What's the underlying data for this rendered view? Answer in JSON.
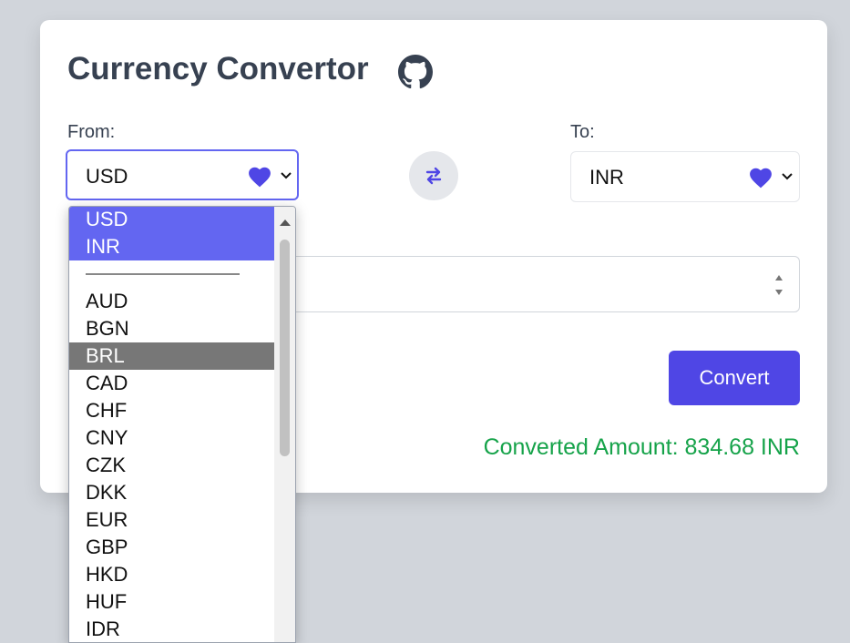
{
  "app": {
    "title": "Currency Convertor",
    "github_icon": "github-icon"
  },
  "from": {
    "label": "From:",
    "value": "USD",
    "favorite_icon": "heart-icon",
    "heart_color": "#4f46e5"
  },
  "to": {
    "label": "To:",
    "value": "INR",
    "favorite_icon": "heart-icon"
  },
  "swap": {
    "icon": "swap-arrows-icon"
  },
  "amount": {
    "value": ""
  },
  "convert_button": {
    "label": "Convert",
    "color": "#4f46e5"
  },
  "result": {
    "text": "Converted Amount: 834.68 INR",
    "color": "#16a34a"
  },
  "dropdown": {
    "favorites": [
      "USD",
      "INR"
    ],
    "options": [
      "AUD",
      "BGN",
      "BRL",
      "CAD",
      "CHF",
      "CNY",
      "CZK",
      "DKK",
      "EUR",
      "GBP",
      "HKD",
      "HUF",
      "IDR"
    ],
    "hovered": "BRL",
    "selected_color": "#6366f1",
    "hover_color": "#777777"
  }
}
